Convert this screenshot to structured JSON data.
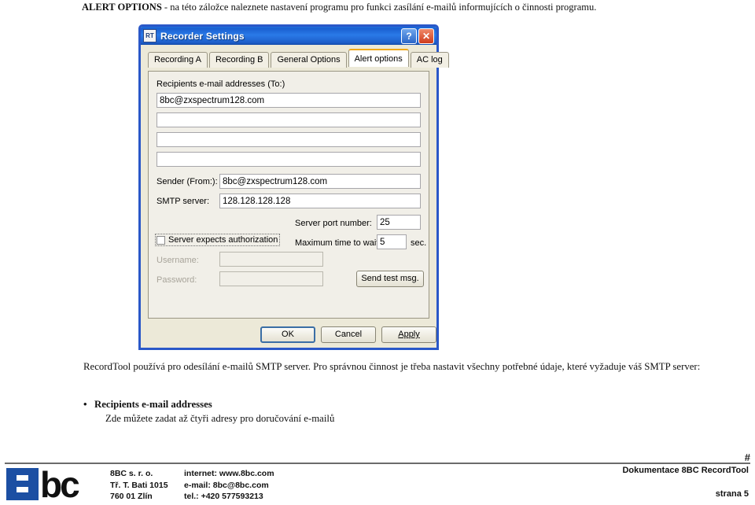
{
  "intro": {
    "lead": "ALERT OPTIONS",
    "rest": " - na této záložce naleznete nastavení programu pro funkci zasílání e-mailů informujících o činnosti programu."
  },
  "dialog": {
    "title": "Recorder Settings",
    "app_icon_text": "RT",
    "titlebar_color": "#1d5ec9",
    "help_button": "?",
    "close_button": "✕",
    "tabs": [
      {
        "label": "Recording A",
        "active": false
      },
      {
        "label": "Recording B",
        "active": false
      },
      {
        "label": "General Options",
        "active": false
      },
      {
        "label": "Alert options",
        "active": true
      },
      {
        "label": "AC log",
        "active": false
      }
    ],
    "active_tab_accent": "#f0a818",
    "form": {
      "recipients_label": "Recipients e-mail addresses (To:)",
      "recipients": [
        "8bc@zxspectrum128.com",
        "",
        "",
        ""
      ],
      "recipients_placeholder": "",
      "sender_label": "Sender (From:):",
      "sender_value": "8bc@zxspectrum128.com",
      "smtp_label": "SMTP server:",
      "smtp_value": "128.128.128.128",
      "port_label": "Server port number:",
      "port_value": "25",
      "timeout_label": "Maximum time to wait:",
      "timeout_value": "5",
      "timeout_unit": "sec.",
      "auth_checkbox_label": "Server expects authorization",
      "auth_checked": false,
      "username_label": "Username:",
      "username_value": "",
      "password_label": "Password:",
      "password_value": "",
      "send_test_label": "Send test msg."
    },
    "buttons": {
      "ok": "OK",
      "cancel": "Cancel",
      "apply": "Apply"
    }
  },
  "body": {
    "paragraph": "RecordTool používá pro odesílání e-mailů SMTP server. Pro správnou činnost je třeba nastavit všechny potřebné údaje, které vyžaduje váš SMTP server:",
    "bullet_title": "Recipients e-mail addresses",
    "bullet_text": "Zde můžete zadat až čtyři adresy pro doručování e-mailů"
  },
  "footer": {
    "hash": "#",
    "logo_word": "bc",
    "company": "8BC s. r. o.",
    "street": "Tř. T. Bati 1015",
    "city": "760 01 Zlín",
    "internet": "internet: www.8bc.com",
    "email": "e-mail: 8bc@8bc.com",
    "tel": "tel.: +420 577593213",
    "doc_title": "Dokumentace 8BC RecordTool",
    "page": "strana 5"
  }
}
